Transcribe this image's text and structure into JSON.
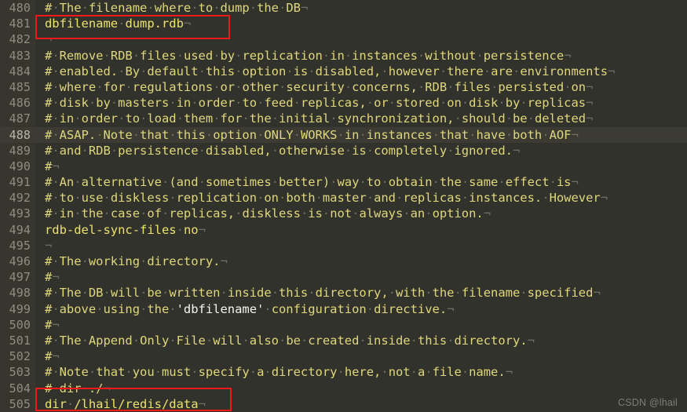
{
  "editor": {
    "type": "terminal-text-editor",
    "theme": {
      "background": "#32322c",
      "gutter_background": "#36362f",
      "current_line_background": "#3b3b34",
      "comment_color": "#dfd77b",
      "keyword_color": "#eae26f",
      "string_color": "#f4f4f0",
      "line_number_color": "#8e8e84",
      "whitespace_dot_color": "#6f6f62",
      "annotation_color": "#f01919"
    },
    "first_line_number": 480,
    "last_line_number": 505,
    "current_line_number": 488
  },
  "lines": [
    {
      "num": "480",
      "text": "# The filename where to dump the DB",
      "kind": "comment",
      "eol": true
    },
    {
      "num": "481",
      "text": "dbfilename dump.rdb",
      "kind": "directive",
      "eol": true
    },
    {
      "num": "482",
      "text": "",
      "kind": "blank",
      "eol": true
    },
    {
      "num": "483",
      "text": "# Remove RDB files used by replication in instances without persistence",
      "kind": "comment",
      "eol": true
    },
    {
      "num": "484",
      "text": "# enabled. By default this option is disabled, however there are environments",
      "kind": "comment",
      "eol": true
    },
    {
      "num": "485",
      "text": "# where for regulations or other security concerns, RDB files persisted on",
      "kind": "comment",
      "eol": true
    },
    {
      "num": "486",
      "text": "# disk by masters in order to feed replicas, or stored on disk by replicas",
      "kind": "comment",
      "eol": true
    },
    {
      "num": "487",
      "text": "# in order to load them for the initial synchronization, should be deleted",
      "kind": "comment",
      "eol": true
    },
    {
      "num": "488",
      "text": "# ASAP. Note that this option ONLY WORKS in instances that have both AOF",
      "kind": "comment",
      "eol": true,
      "current": true
    },
    {
      "num": "489",
      "text": "# and RDB persistence disabled, otherwise is completely ignored.",
      "kind": "comment",
      "eol": true
    },
    {
      "num": "490",
      "text": "#",
      "kind": "comment",
      "eol": true
    },
    {
      "num": "491",
      "text": "# An alternative (and sometimes better) way to obtain the same effect is",
      "kind": "comment",
      "eol": true
    },
    {
      "num": "492",
      "text": "# to use diskless replication on both master and replicas instances. However",
      "kind": "comment",
      "eol": true
    },
    {
      "num": "493",
      "text": "# in the case of replicas, diskless is not always an option.",
      "kind": "comment",
      "eol": true
    },
    {
      "num": "494",
      "text": "rdb-del-sync-files no",
      "kind": "directive",
      "eol": true
    },
    {
      "num": "495",
      "text": "",
      "kind": "blank",
      "eol": true
    },
    {
      "num": "496",
      "text": "# The working directory.",
      "kind": "comment",
      "eol": true
    },
    {
      "num": "497",
      "text": "#",
      "kind": "comment",
      "eol": true
    },
    {
      "num": "498",
      "text": "# The DB will be written inside this directory, with the filename specified",
      "kind": "comment",
      "eol": true
    },
    {
      "num": "499",
      "text": "# above using the 'dbfilename' configuration directive.",
      "kind": "comment",
      "eol": true,
      "quoted": "'dbfilename'"
    },
    {
      "num": "500",
      "text": "#",
      "kind": "comment",
      "eol": true
    },
    {
      "num": "501",
      "text": "# The Append Only File will also be created inside this directory.",
      "kind": "comment",
      "eol": true
    },
    {
      "num": "502",
      "text": "#",
      "kind": "comment",
      "eol": true
    },
    {
      "num": "503",
      "text": "# Note that you must specify a directory here, not a file name.",
      "kind": "comment",
      "eol": true
    },
    {
      "num": "504",
      "text": "# dir ./",
      "kind": "comment",
      "eol": true
    },
    {
      "num": "505",
      "text": "dir /lhail/redis/data",
      "kind": "directive",
      "eol": true
    }
  ],
  "annotations": [
    {
      "name": "dbfilename-highlight",
      "target_line": "481",
      "label": "dbfilename dump.rdb"
    },
    {
      "name": "dir-highlight",
      "target_line": "505",
      "label": "dir /lhail/redis/data"
    }
  ],
  "watermark": {
    "text": "CSDN @lhail"
  },
  "glyphs": {
    "eol_marker": "¬",
    "space_marker": "·"
  }
}
